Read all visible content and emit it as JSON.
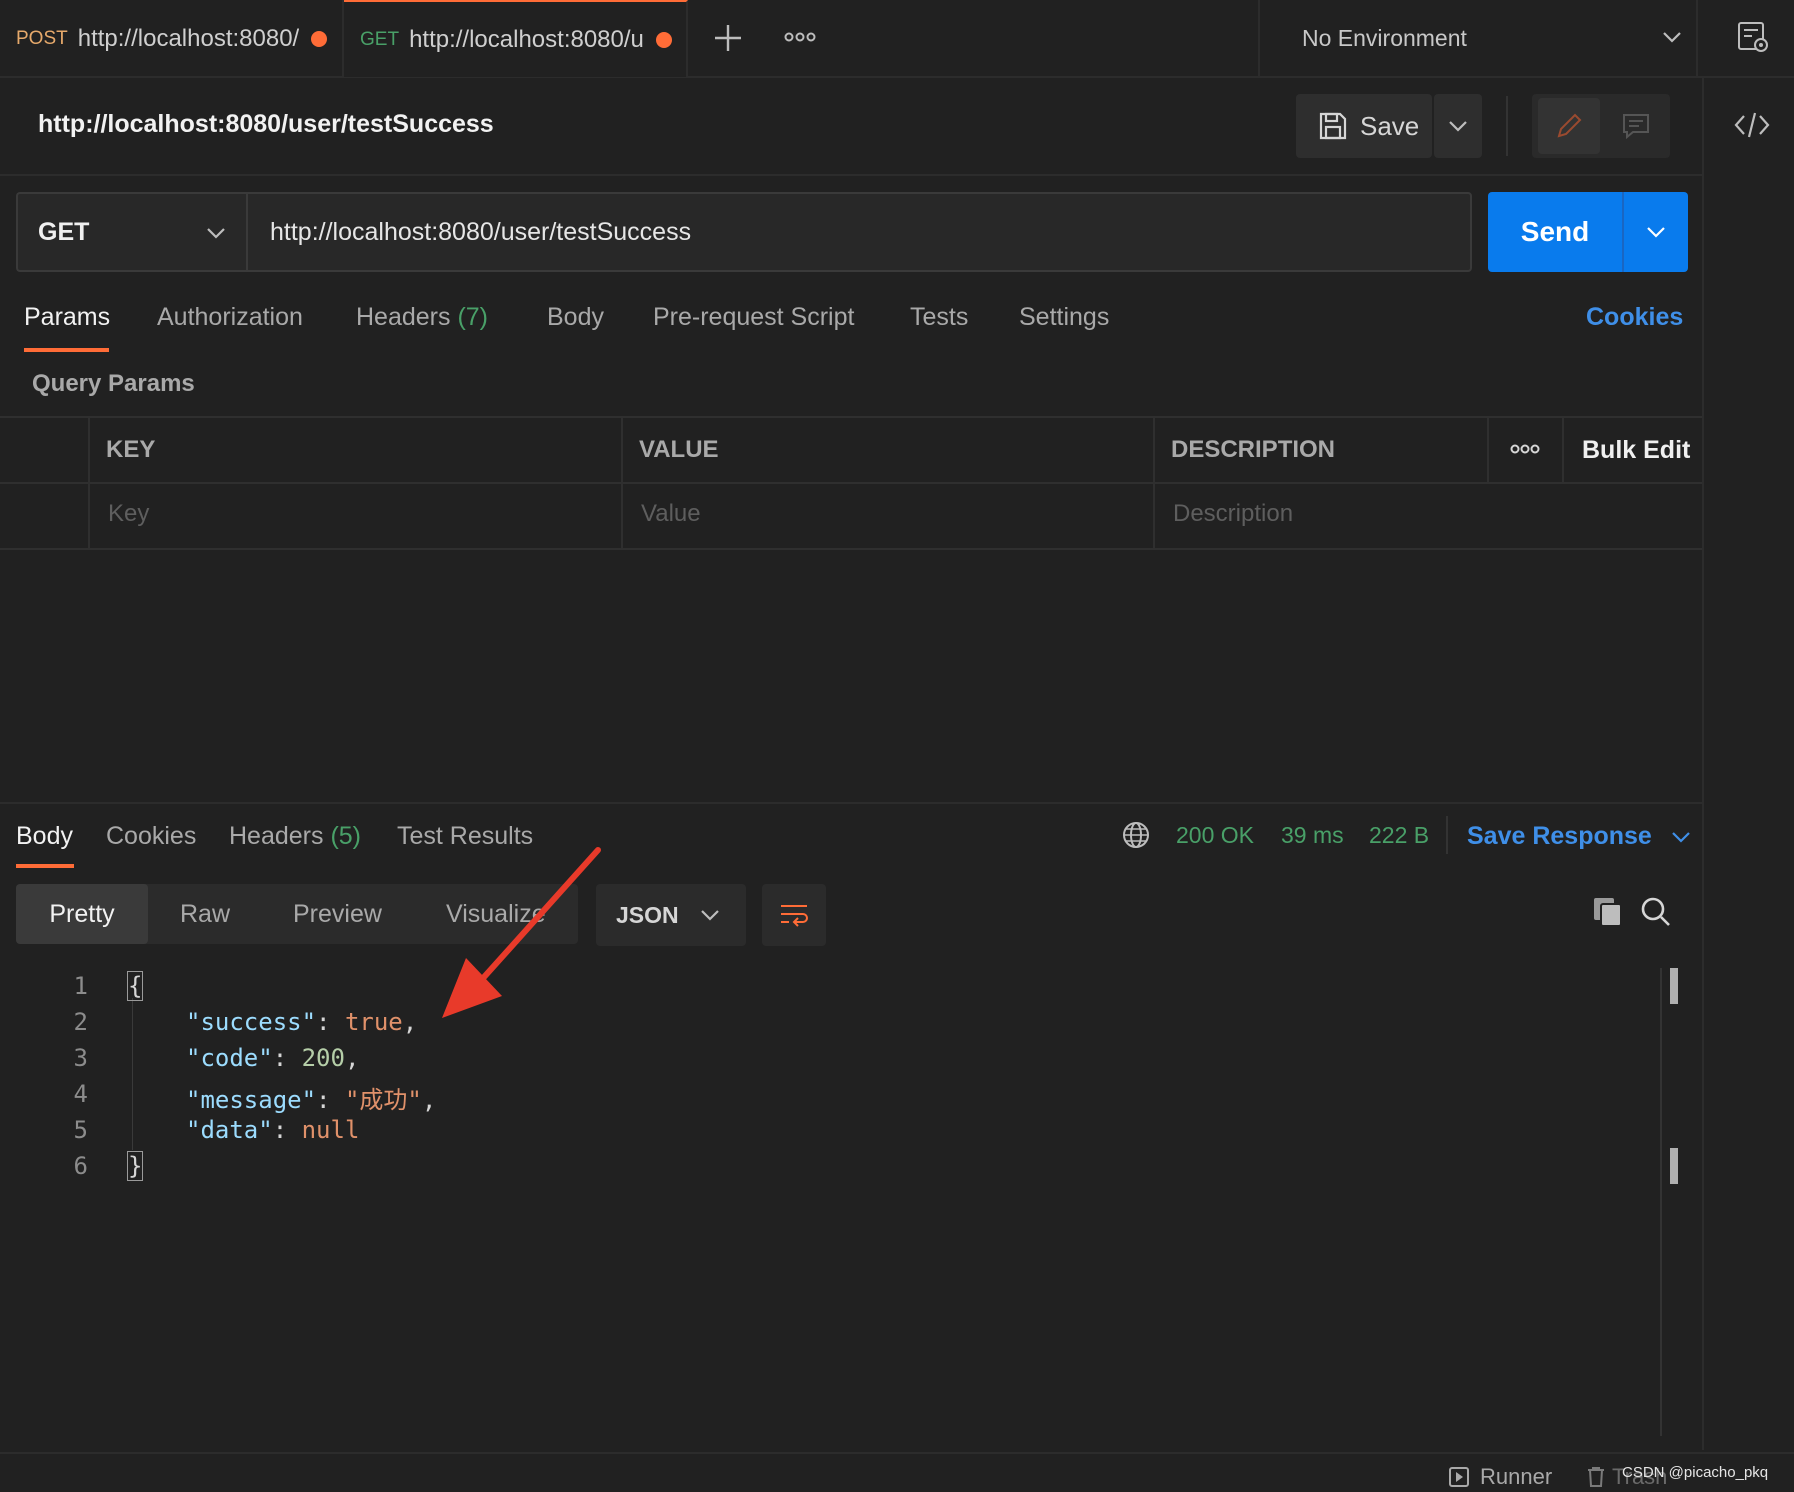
{
  "tabs": [
    {
      "method": "POST",
      "url": "http://localhost:8080/",
      "method_color": "#e6a96b"
    },
    {
      "method": "GET",
      "url": "http://localhost:8080/u",
      "method_color": "#49a068"
    }
  ],
  "environment": "No Environment",
  "request": {
    "title": "http://localhost:8080/user/testSuccess",
    "method": "GET",
    "url": "http://localhost:8080/user/testSuccess",
    "save_label": "Save",
    "send_label": "Send"
  },
  "request_tabs": {
    "params": "Params",
    "authorization": "Authorization",
    "headers": "Headers",
    "headers_count": "(7)",
    "body": "Body",
    "pre_request": "Pre-request Script",
    "tests": "Tests",
    "settings": "Settings",
    "cookies": "Cookies"
  },
  "query_params": {
    "title": "Query Params",
    "columns": [
      "KEY",
      "VALUE",
      "DESCRIPTION"
    ],
    "bulk_edit": "Bulk Edit",
    "placeholders": {
      "key": "Key",
      "value": "Value",
      "description": "Description"
    }
  },
  "response": {
    "tabs": {
      "body": "Body",
      "cookies": "Cookies",
      "headers": "Headers",
      "headers_count": "(5)",
      "test_results": "Test Results"
    },
    "status": "200 OK",
    "time": "39 ms",
    "size": "222 B",
    "save_response": "Save Response",
    "views": [
      "Pretty",
      "Raw",
      "Preview",
      "Visualize"
    ],
    "format": "JSON",
    "lines": [
      {
        "num": "1",
        "open": "{"
      },
      {
        "num": "2",
        "key": "\"success\"",
        "colon": ": ",
        "value": "true",
        "comma": ","
      },
      {
        "num": "3",
        "key": "\"code\"",
        "colon": ": ",
        "value": "200",
        "comma": ","
      },
      {
        "num": "4",
        "key": "\"message\"",
        "colon": ": ",
        "value": "\"成功\"",
        "comma": ","
      },
      {
        "num": "5",
        "key": "\"data\"",
        "colon": ": ",
        "value": "null",
        "comma": ""
      },
      {
        "num": "6",
        "close": "}"
      }
    ]
  },
  "footer": {
    "runner": "Runner",
    "trash": "Trash",
    "watermark": "CSDN @picacho_pkq"
  },
  "colors": {
    "accent": "#ff6c37",
    "send": "#097bed",
    "link": "#3f8fe8",
    "success": "#49a068"
  }
}
